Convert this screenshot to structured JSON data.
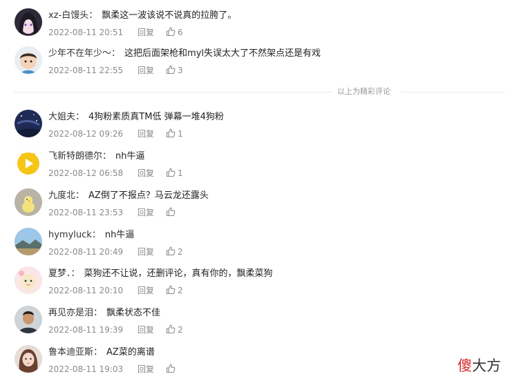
{
  "featured_comments": [
    {
      "user": "xz-白馒头",
      "text": "飘柔这一波该说不说真的拉胯了。",
      "time": "2022-08-11 20:51",
      "reply": "回复",
      "likes": "6",
      "avatar": "avatar-anime-girl"
    },
    {
      "user": "少年不在年少～",
      "text": "这把后面架枪和myl失误太大了不然架点还是有戏",
      "time": "2022-08-11 22:55",
      "reply": "回复",
      "likes": "3",
      "avatar": "avatar-cartoon-boy"
    }
  ],
  "divider_text": "以上为精彩评论",
  "comments": [
    {
      "user": "大姐夫",
      "text": "4狗粉素质真TM低 弹幕一堆4狗粉",
      "time": "2022-08-12 09:26",
      "reply": "回复",
      "likes": "1",
      "avatar": "avatar-night-sky"
    },
    {
      "user": "飞新特朗德尔",
      "text": "nh牛逼",
      "time": "2022-08-12 06:58",
      "reply": "回复",
      "likes": "1",
      "avatar": "avatar-yellow-play"
    },
    {
      "user": "九度北",
      "text": "AZ倒了不报点？马云龙还露头",
      "time": "2022-08-11 23:53",
      "reply": "回复",
      "likes": "",
      "avatar": "avatar-chick"
    },
    {
      "user": "hymyluck",
      "text": "nh牛逼",
      "time": "2022-08-11 20:49",
      "reply": "回复",
      "likes": "2",
      "avatar": "avatar-landscape"
    },
    {
      "user": "夏梦．",
      "text": "菜狗还不让说，还删评论，真有你的，飘柔菜狗",
      "time": "2022-08-11 20:10",
      "reply": "回复",
      "likes": "2",
      "avatar": "avatar-cartoon-pink"
    },
    {
      "user": "再见亦是泪",
      "text": "飘柔状态不佳",
      "time": "2022-08-11 19:39",
      "reply": "回复",
      "likes": "2",
      "avatar": "avatar-man-photo"
    },
    {
      "user": "鲁本迪亚斯",
      "text": "AZ菜的离谱",
      "time": "2022-08-11 19:03",
      "reply": "回复",
      "likes": "",
      "avatar": "avatar-girl-photo"
    }
  ],
  "watermark": {
    "part1": "傻",
    "part2": "大方"
  },
  "colors": {
    "watermark_accent": "#d7262a",
    "meta_gray": "#8a8a8a"
  }
}
